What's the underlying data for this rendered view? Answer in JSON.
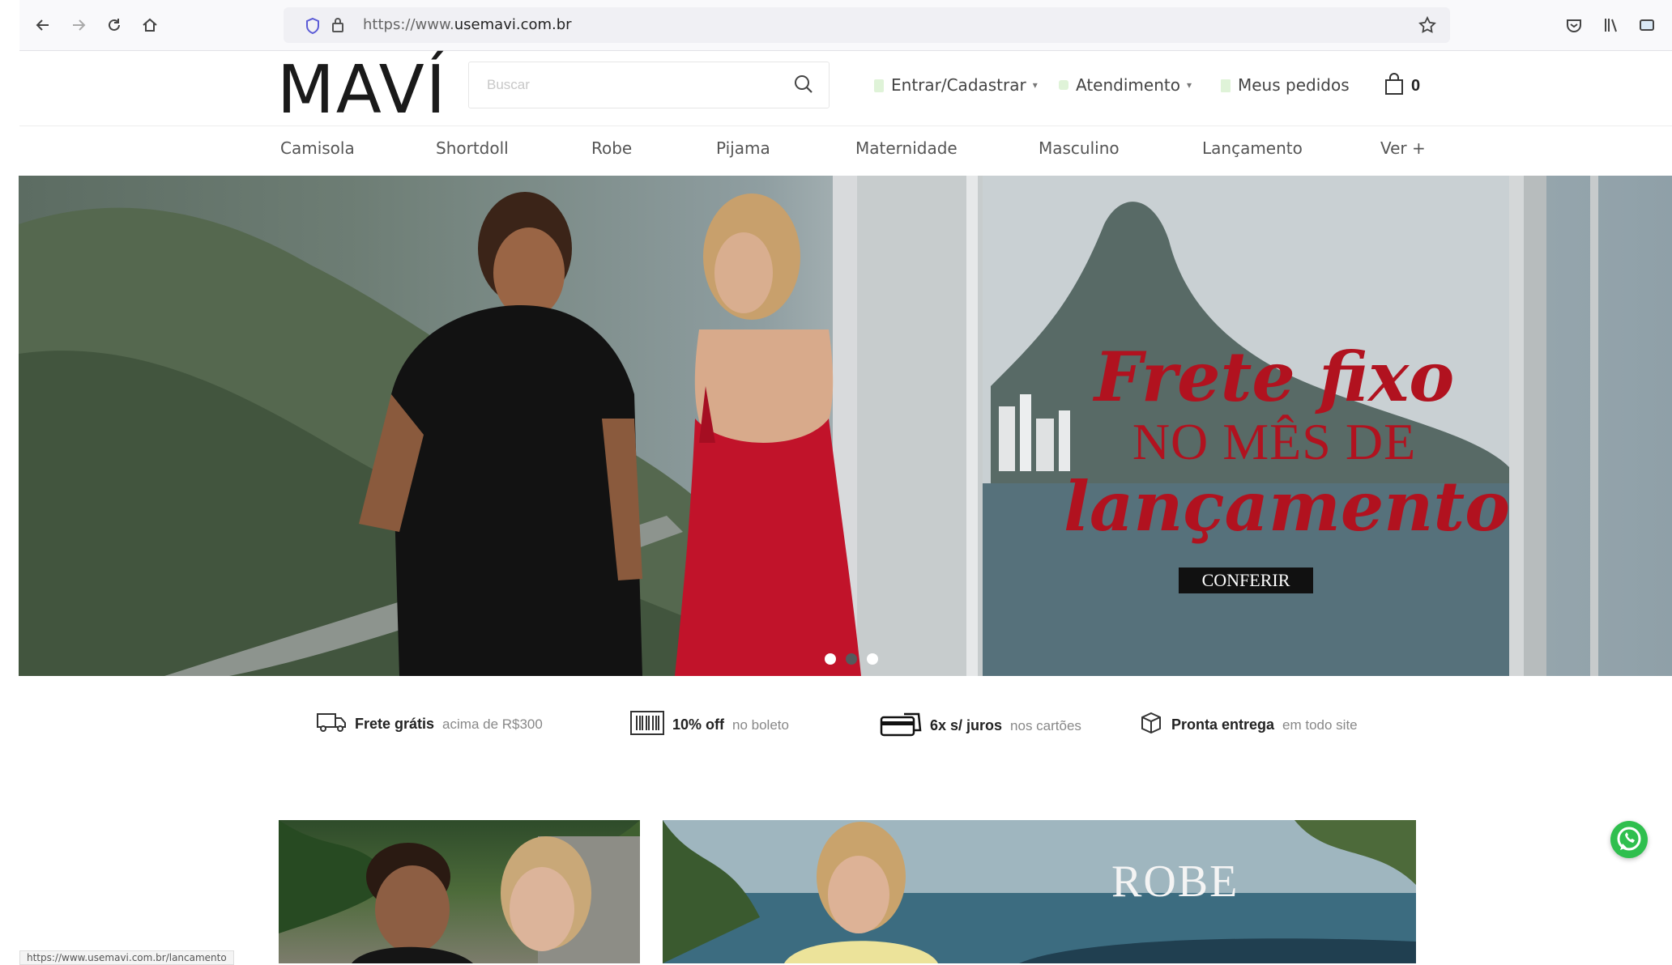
{
  "browser": {
    "url_prefix": "https://www.",
    "url_domain": "usemavi.com.br"
  },
  "header": {
    "logo": "MAVÍ",
    "search_placeholder": "Buscar",
    "login_label": "Entrar/Cadastrar",
    "support_label": "Atendimento",
    "orders_label": "Meus pedidos",
    "cart_count": "0"
  },
  "menu": {
    "items": [
      "Camisola",
      "Shortdoll",
      "Robe",
      "Pijama",
      "Maternidade",
      "Masculino",
      "Lançamento",
      "Ver +"
    ]
  },
  "hero": {
    "line1": "Frete fixo",
    "line2": "NO MÊS DE",
    "line3": "lançamento",
    "cta": "CONFERIR",
    "active_slide": 1,
    "slide_count": 3
  },
  "benefits": [
    {
      "strong": "Frete grátis",
      "light": "acima de R$300",
      "icon": "truck-icon"
    },
    {
      "strong": "10% off",
      "light": "no boleto",
      "icon": "barcode-icon"
    },
    {
      "strong": "6x s/ juros",
      "light": "nos cartões",
      "icon": "credit-card-icon"
    },
    {
      "strong": "Pronta entrega",
      "light": "em todo site",
      "icon": "box-icon"
    }
  ],
  "banners": {
    "right_label": "ROBE"
  },
  "status_bar": "https://www.usemavi.com.br/lancamento",
  "colors": {
    "brand_red": "#b1121f",
    "whatsapp": "#2fbf4e"
  }
}
